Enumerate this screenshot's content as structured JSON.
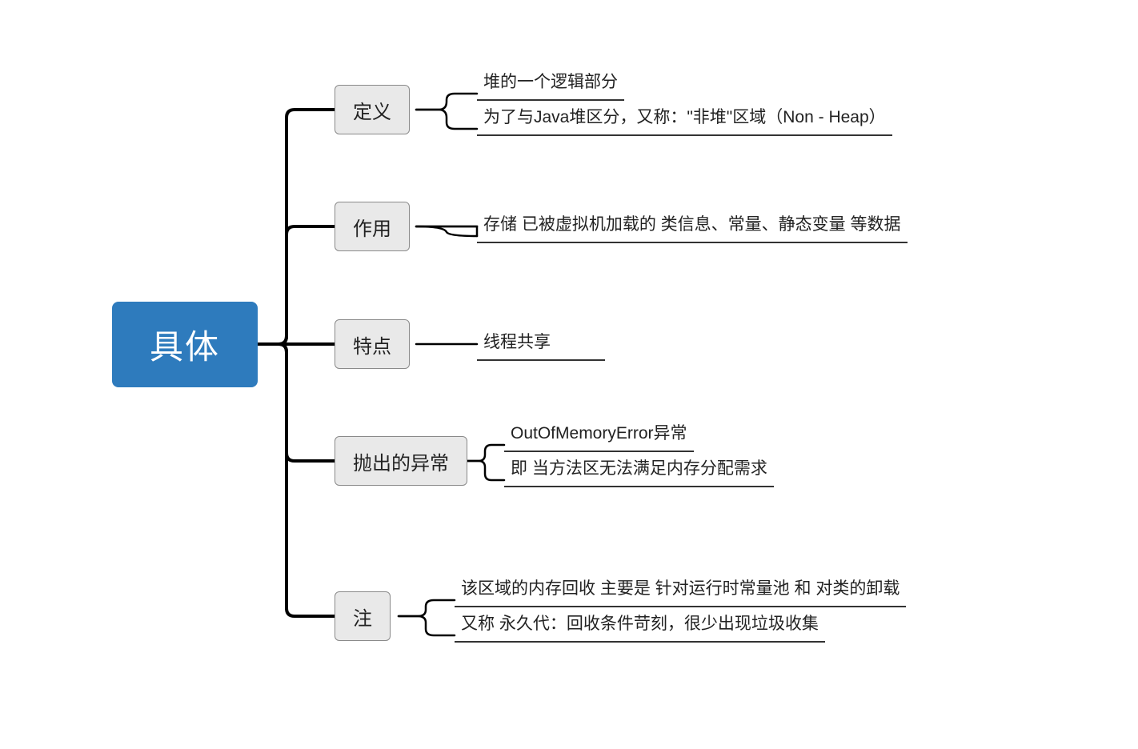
{
  "root": "具体",
  "branches": [
    {
      "label": "定义",
      "leaves": [
        "堆的一个逻辑部分",
        "为了与Java堆区分，又称：\"非堆\"区域（Non - Heap）"
      ]
    },
    {
      "label": "作用",
      "leaves": [
        "存储 已被虚拟机加载的 类信息、常量、静态变量 等数据"
      ]
    },
    {
      "label": "特点",
      "leaves": [
        "线程共享"
      ]
    },
    {
      "label": "抛出的异常",
      "leaves": [
        "OutOfMemoryError异常",
        "即 当方法区无法满足内存分配需求"
      ]
    },
    {
      "label": "注",
      "leaves": [
        "该区域的内存回收 主要是 针对运行时常量池 和 对类的卸载",
        "又称 永久代：回收条件苛刻，很少出现垃圾收集"
      ]
    }
  ]
}
